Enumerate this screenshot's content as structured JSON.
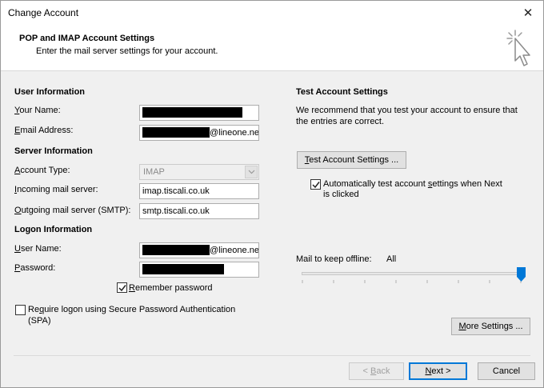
{
  "window": {
    "title": "Change Account",
    "close_glyph": "✕"
  },
  "header": {
    "title": "POP and IMAP Account Settings",
    "subtitle": "Enter the mail server settings for your account."
  },
  "user_info": {
    "heading": "User Information",
    "name_label_u": "Y",
    "name_label_rest": "our Name:",
    "email_label_u": "E",
    "email_label_rest": "mail Address:",
    "email_suffix": "@lineone.ne"
  },
  "server_info": {
    "heading": "Server Information",
    "account_type_label_u": "A",
    "account_type_label_rest": "ccount Type:",
    "account_type_value": "IMAP",
    "incoming_label_u": "I",
    "incoming_label_rest": "ncoming mail server:",
    "incoming_value": "imap.tiscali.co.uk",
    "outgoing_label_u": "O",
    "outgoing_label_rest": "utgoing mail server (SMTP):",
    "outgoing_value": "smtp.tiscali.co.uk"
  },
  "logon_info": {
    "heading": "Logon Information",
    "username_label_u": "U",
    "username_label_rest": "ser Name:",
    "username_suffix": "@lineone.ne",
    "password_label_u": "P",
    "password_label_rest": "assword:",
    "remember_u": "R",
    "remember_rest": "emember password",
    "remember_checked": true,
    "spa_u": "q",
    "spa_pre": "Re",
    "spa_rest": "uire logon using Secure Password Authentication",
    "spa_line2": "(SPA)",
    "spa_checked": false
  },
  "test_settings": {
    "heading": "Test Account Settings",
    "desc_line1": "We recommend that you test your account to ensure that",
    "desc_line2": "the entries are correct.",
    "button_u": "T",
    "button_rest": "est Account Settings ...",
    "auto_pre": "Automatically test account ",
    "auto_u": "s",
    "auto_rest": "ettings when Next",
    "auto_line2": "is clicked",
    "auto_checked": true
  },
  "offline": {
    "label": "Mail to keep offline:",
    "value": "All",
    "slider_level": 1.0
  },
  "buttons": {
    "more_u": "M",
    "more_rest": "ore Settings ...",
    "back_pre": "< ",
    "back_u": "B",
    "back_rest": "ack",
    "next_u": "N",
    "next_rest": "ext >",
    "cancel": "Cancel"
  },
  "colors": {
    "accent": "#0078d7",
    "redaction": "#000000"
  },
  "icons": {
    "header": "cursor-click-icon",
    "check": "checkmark-icon",
    "dropdown": "chevron-down-icon"
  }
}
